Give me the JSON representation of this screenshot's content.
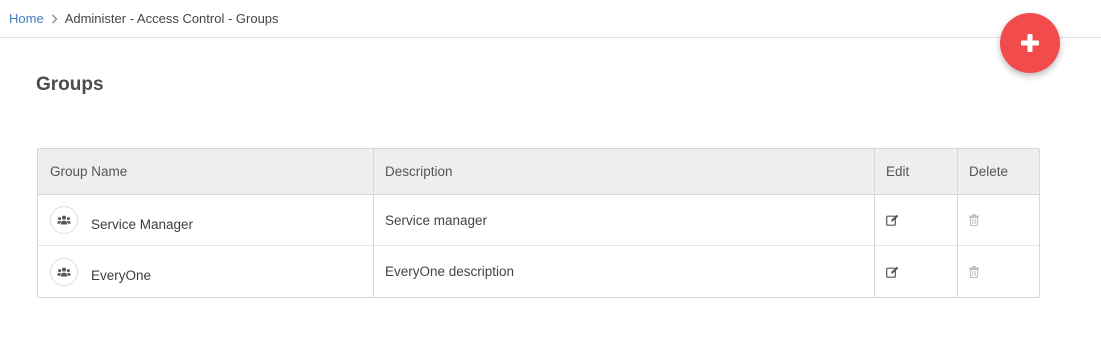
{
  "breadcrumb": {
    "home": "Home",
    "current": "Administer - Access Control - Groups"
  },
  "page": {
    "title": "Groups"
  },
  "fab": {
    "icon": "plus-icon",
    "color": "#f24b4b"
  },
  "table": {
    "columns": {
      "name": "Group Name",
      "description": "Description",
      "edit": "Edit",
      "delete": "Delete"
    },
    "rows": [
      {
        "name": "Service Manager",
        "description": "Service manager",
        "icon": "group-icon",
        "edit_icon": "edit-icon",
        "delete_icon": "trash-icon"
      },
      {
        "name": "EveryOne",
        "description": "EveryOne description",
        "icon": "group-icon",
        "edit_icon": "edit-icon",
        "delete_icon": "trash-icon"
      }
    ]
  },
  "colors": {
    "link": "#3f7fc4",
    "header_bg": "#eeeeee",
    "border": "#d6d6d6"
  }
}
